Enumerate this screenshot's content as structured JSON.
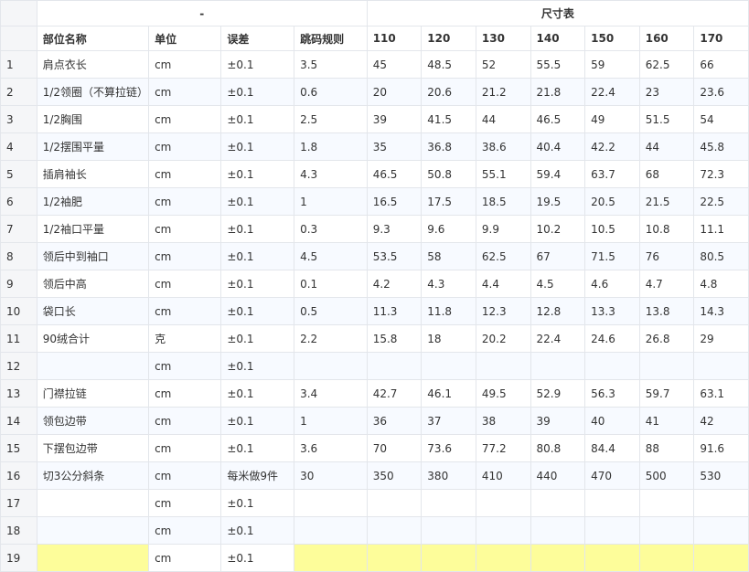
{
  "group_header": {
    "left_label": "-",
    "right_label": "尺寸表"
  },
  "headers": [
    "部位名称",
    "单位",
    "误差",
    "跳码规则",
    "110",
    "120",
    "130",
    "140",
    "150",
    "160",
    "170"
  ],
  "rows": [
    {
      "idx": "1",
      "name": "肩点衣长",
      "unit": "cm",
      "tol": "±0.1",
      "rule": "3.5",
      "sizes": [
        "45",
        "48.5",
        "52",
        "55.5",
        "59",
        "62.5",
        "66"
      ]
    },
    {
      "idx": "2",
      "name": "1/2领圈（不算拉链）",
      "unit": "cm",
      "tol": "±0.1",
      "rule": "0.6",
      "sizes": [
        "20",
        "20.6",
        "21.2",
        "21.8",
        "22.4",
        "23",
        "23.6"
      ]
    },
    {
      "idx": "3",
      "name": "1/2胸围",
      "unit": "cm",
      "tol": "±0.1",
      "rule": "2.5",
      "sizes": [
        "39",
        "41.5",
        "44",
        "46.5",
        "49",
        "51.5",
        "54"
      ]
    },
    {
      "idx": "4",
      "name": "1/2摆围平量",
      "unit": "cm",
      "tol": "±0.1",
      "rule": "1.8",
      "sizes": [
        "35",
        "36.8",
        "38.6",
        "40.4",
        "42.2",
        "44",
        "45.8"
      ]
    },
    {
      "idx": "5",
      "name": "插肩袖长",
      "unit": "cm",
      "tol": "±0.1",
      "rule": "4.3",
      "sizes": [
        "46.5",
        "50.8",
        "55.1",
        "59.4",
        "63.7",
        "68",
        "72.3"
      ]
    },
    {
      "idx": "6",
      "name": "1/2袖肥",
      "unit": "cm",
      "tol": "±0.1",
      "rule": "1",
      "sizes": [
        "16.5",
        "17.5",
        "18.5",
        "19.5",
        "20.5",
        "21.5",
        "22.5"
      ]
    },
    {
      "idx": "7",
      "name": "1/2袖口平量",
      "unit": "cm",
      "tol": "±0.1",
      "rule": "0.3",
      "sizes": [
        "9.3",
        "9.6",
        "9.9",
        "10.2",
        "10.5",
        "10.8",
        "11.1"
      ]
    },
    {
      "idx": "8",
      "name": "领后中到袖口",
      "unit": "cm",
      "tol": "±0.1",
      "rule": "4.5",
      "sizes": [
        "53.5",
        "58",
        "62.5",
        "67",
        "71.5",
        "76",
        "80.5"
      ]
    },
    {
      "idx": "9",
      "name": "领后中高",
      "unit": "cm",
      "tol": "±0.1",
      "rule": "0.1",
      "sizes": [
        "4.2",
        "4.3",
        "4.4",
        "4.5",
        "4.6",
        "4.7",
        "4.8"
      ]
    },
    {
      "idx": "10",
      "name": "袋口长",
      "unit": "cm",
      "tol": "±0.1",
      "rule": "0.5",
      "sizes": [
        "11.3",
        "11.8",
        "12.3",
        "12.8",
        "13.3",
        "13.8",
        "14.3"
      ]
    },
    {
      "idx": "11",
      "name": "90绒合计",
      "unit": "克",
      "tol": "±0.1",
      "rule": "2.2",
      "sizes": [
        "15.8",
        "18",
        "20.2",
        "22.4",
        "24.6",
        "26.8",
        "29"
      ]
    },
    {
      "idx": "12",
      "name": "",
      "unit": "cm",
      "tol": "±0.1",
      "rule": "",
      "sizes": [
        "",
        "",
        "",
        "",
        "",
        "",
        ""
      ]
    },
    {
      "idx": "13",
      "name": "门襟拉链",
      "unit": "cm",
      "tol": "±0.1",
      "rule": "3.4",
      "sizes": [
        "42.7",
        "46.1",
        "49.5",
        "52.9",
        "56.3",
        "59.7",
        "63.1"
      ]
    },
    {
      "idx": "14",
      "name": "领包边带",
      "unit": "cm",
      "tol": "±0.1",
      "rule": "1",
      "sizes": [
        "36",
        "37",
        "38",
        "39",
        "40",
        "41",
        "42"
      ]
    },
    {
      "idx": "15",
      "name": "下摆包边带",
      "unit": "cm",
      "tol": "±0.1",
      "rule": "3.6",
      "sizes": [
        "70",
        "73.6",
        "77.2",
        "80.8",
        "84.4",
        "88",
        "91.6"
      ]
    },
    {
      "idx": "16",
      "name": "切3公分斜条",
      "unit": "cm",
      "tol": "每米做9件",
      "rule": "30",
      "sizes": [
        "350",
        "380",
        "410",
        "440",
        "470",
        "500",
        "530"
      ]
    },
    {
      "idx": "17",
      "name": "",
      "unit": "cm",
      "tol": "±0.1",
      "rule": "",
      "sizes": [
        "",
        "",
        "",
        "",
        "",
        "",
        ""
      ]
    },
    {
      "idx": "18",
      "name": "",
      "unit": "cm",
      "tol": "±0.1",
      "rule": "",
      "sizes": [
        "",
        "",
        "",
        "",
        "",
        "",
        ""
      ]
    },
    {
      "idx": "19",
      "name": "",
      "unit": "cm",
      "tol": "±0.1",
      "rule": "",
      "sizes": [
        "",
        "",
        "",
        "",
        "",
        "",
        ""
      ]
    }
  ],
  "colors": {
    "grid": "#e3e6eb",
    "index_bg": "#f5f6f8",
    "alt_row": "#f7faff",
    "highlight": "#fdfd9a"
  }
}
